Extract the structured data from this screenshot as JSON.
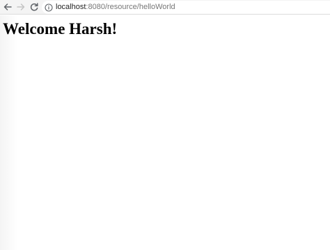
{
  "browser": {
    "url_host": "localhost",
    "url_rest": ":8080/resource/helloWorld",
    "icons": {
      "back": "back-arrow-icon",
      "forward": "forward-arrow-icon",
      "reload": "reload-icon",
      "info": "info-icon"
    }
  },
  "page": {
    "heading": "Welcome Harsh!"
  },
  "colors": {
    "toolbar": "#f4f4f4",
    "url_host": "#1f1f1f",
    "url_rest": "#777777",
    "heading": "#000000"
  }
}
